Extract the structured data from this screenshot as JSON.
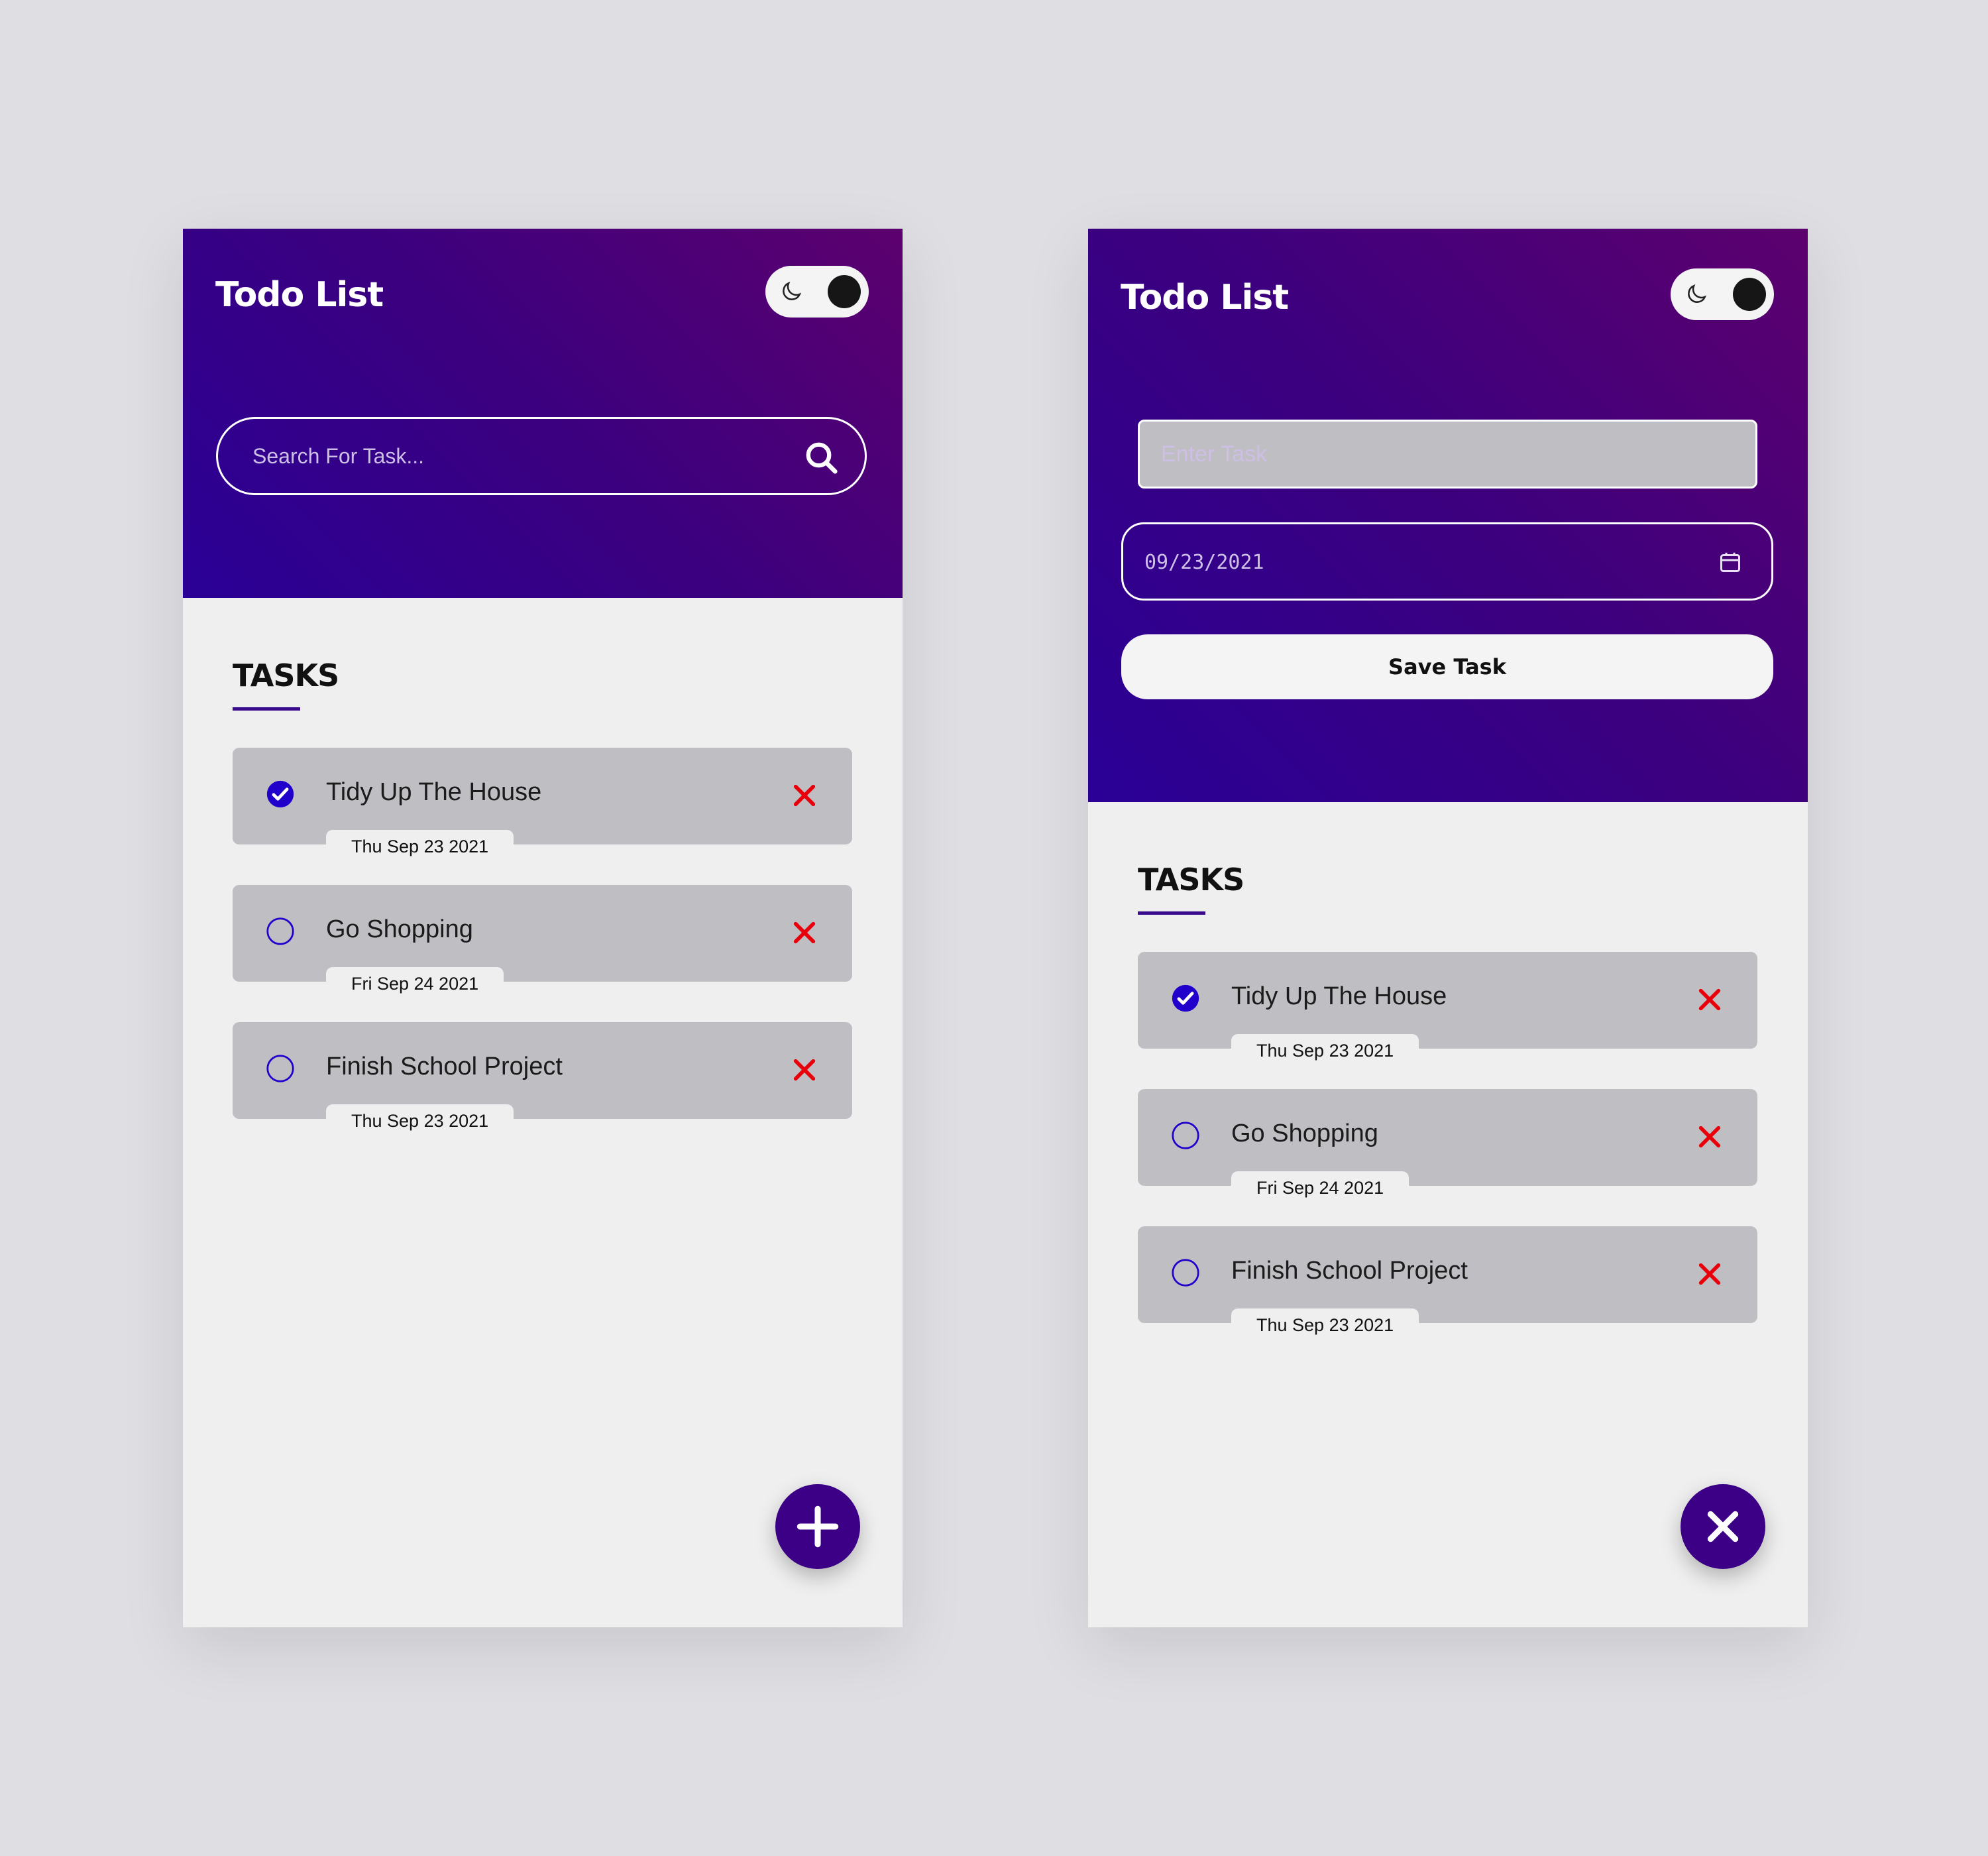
{
  "colors": {
    "header_gradient_start": "#5c006e",
    "header_gradient_end": "#2a0096",
    "accent": "#3c0086",
    "check_blue": "#2200cc",
    "delete_red": "#e8000b",
    "task_bg": "#bfbec3",
    "page_bg": "#dfdee3"
  },
  "left_screen": {
    "title": "Todo List",
    "theme_toggle": {
      "icon": "moon-icon",
      "state": "off"
    },
    "search": {
      "placeholder": "Search For Task...",
      "icon": "search-icon"
    },
    "tasks_heading": "TASKS",
    "tasks": [
      {
        "label": "Tidy Up The House",
        "date": "Thu Sep 23 2021",
        "completed": true
      },
      {
        "label": "Go Shopping",
        "date": "Fri Sep 24 2021",
        "completed": false
      },
      {
        "label": "Finish School Project",
        "date": "Thu Sep 23 2021",
        "completed": false
      }
    ],
    "fab": {
      "icon": "plus-icon"
    }
  },
  "right_screen": {
    "title": "Todo List",
    "theme_toggle": {
      "icon": "moon-icon",
      "state": "off"
    },
    "task_input": {
      "placeholder": "Enter Task"
    },
    "date_input": {
      "value": "09/23/2021",
      "icon": "calendar-icon"
    },
    "save_button": "Save Task",
    "tasks_heading": "TASKS",
    "tasks": [
      {
        "label": "Tidy Up The House",
        "date": "Thu Sep 23 2021",
        "completed": true
      },
      {
        "label": "Go Shopping",
        "date": "Fri Sep 24 2021",
        "completed": false
      },
      {
        "label": "Finish School Project",
        "date": "Thu Sep 23 2021",
        "completed": false
      }
    ],
    "fab": {
      "icon": "close-icon"
    }
  }
}
